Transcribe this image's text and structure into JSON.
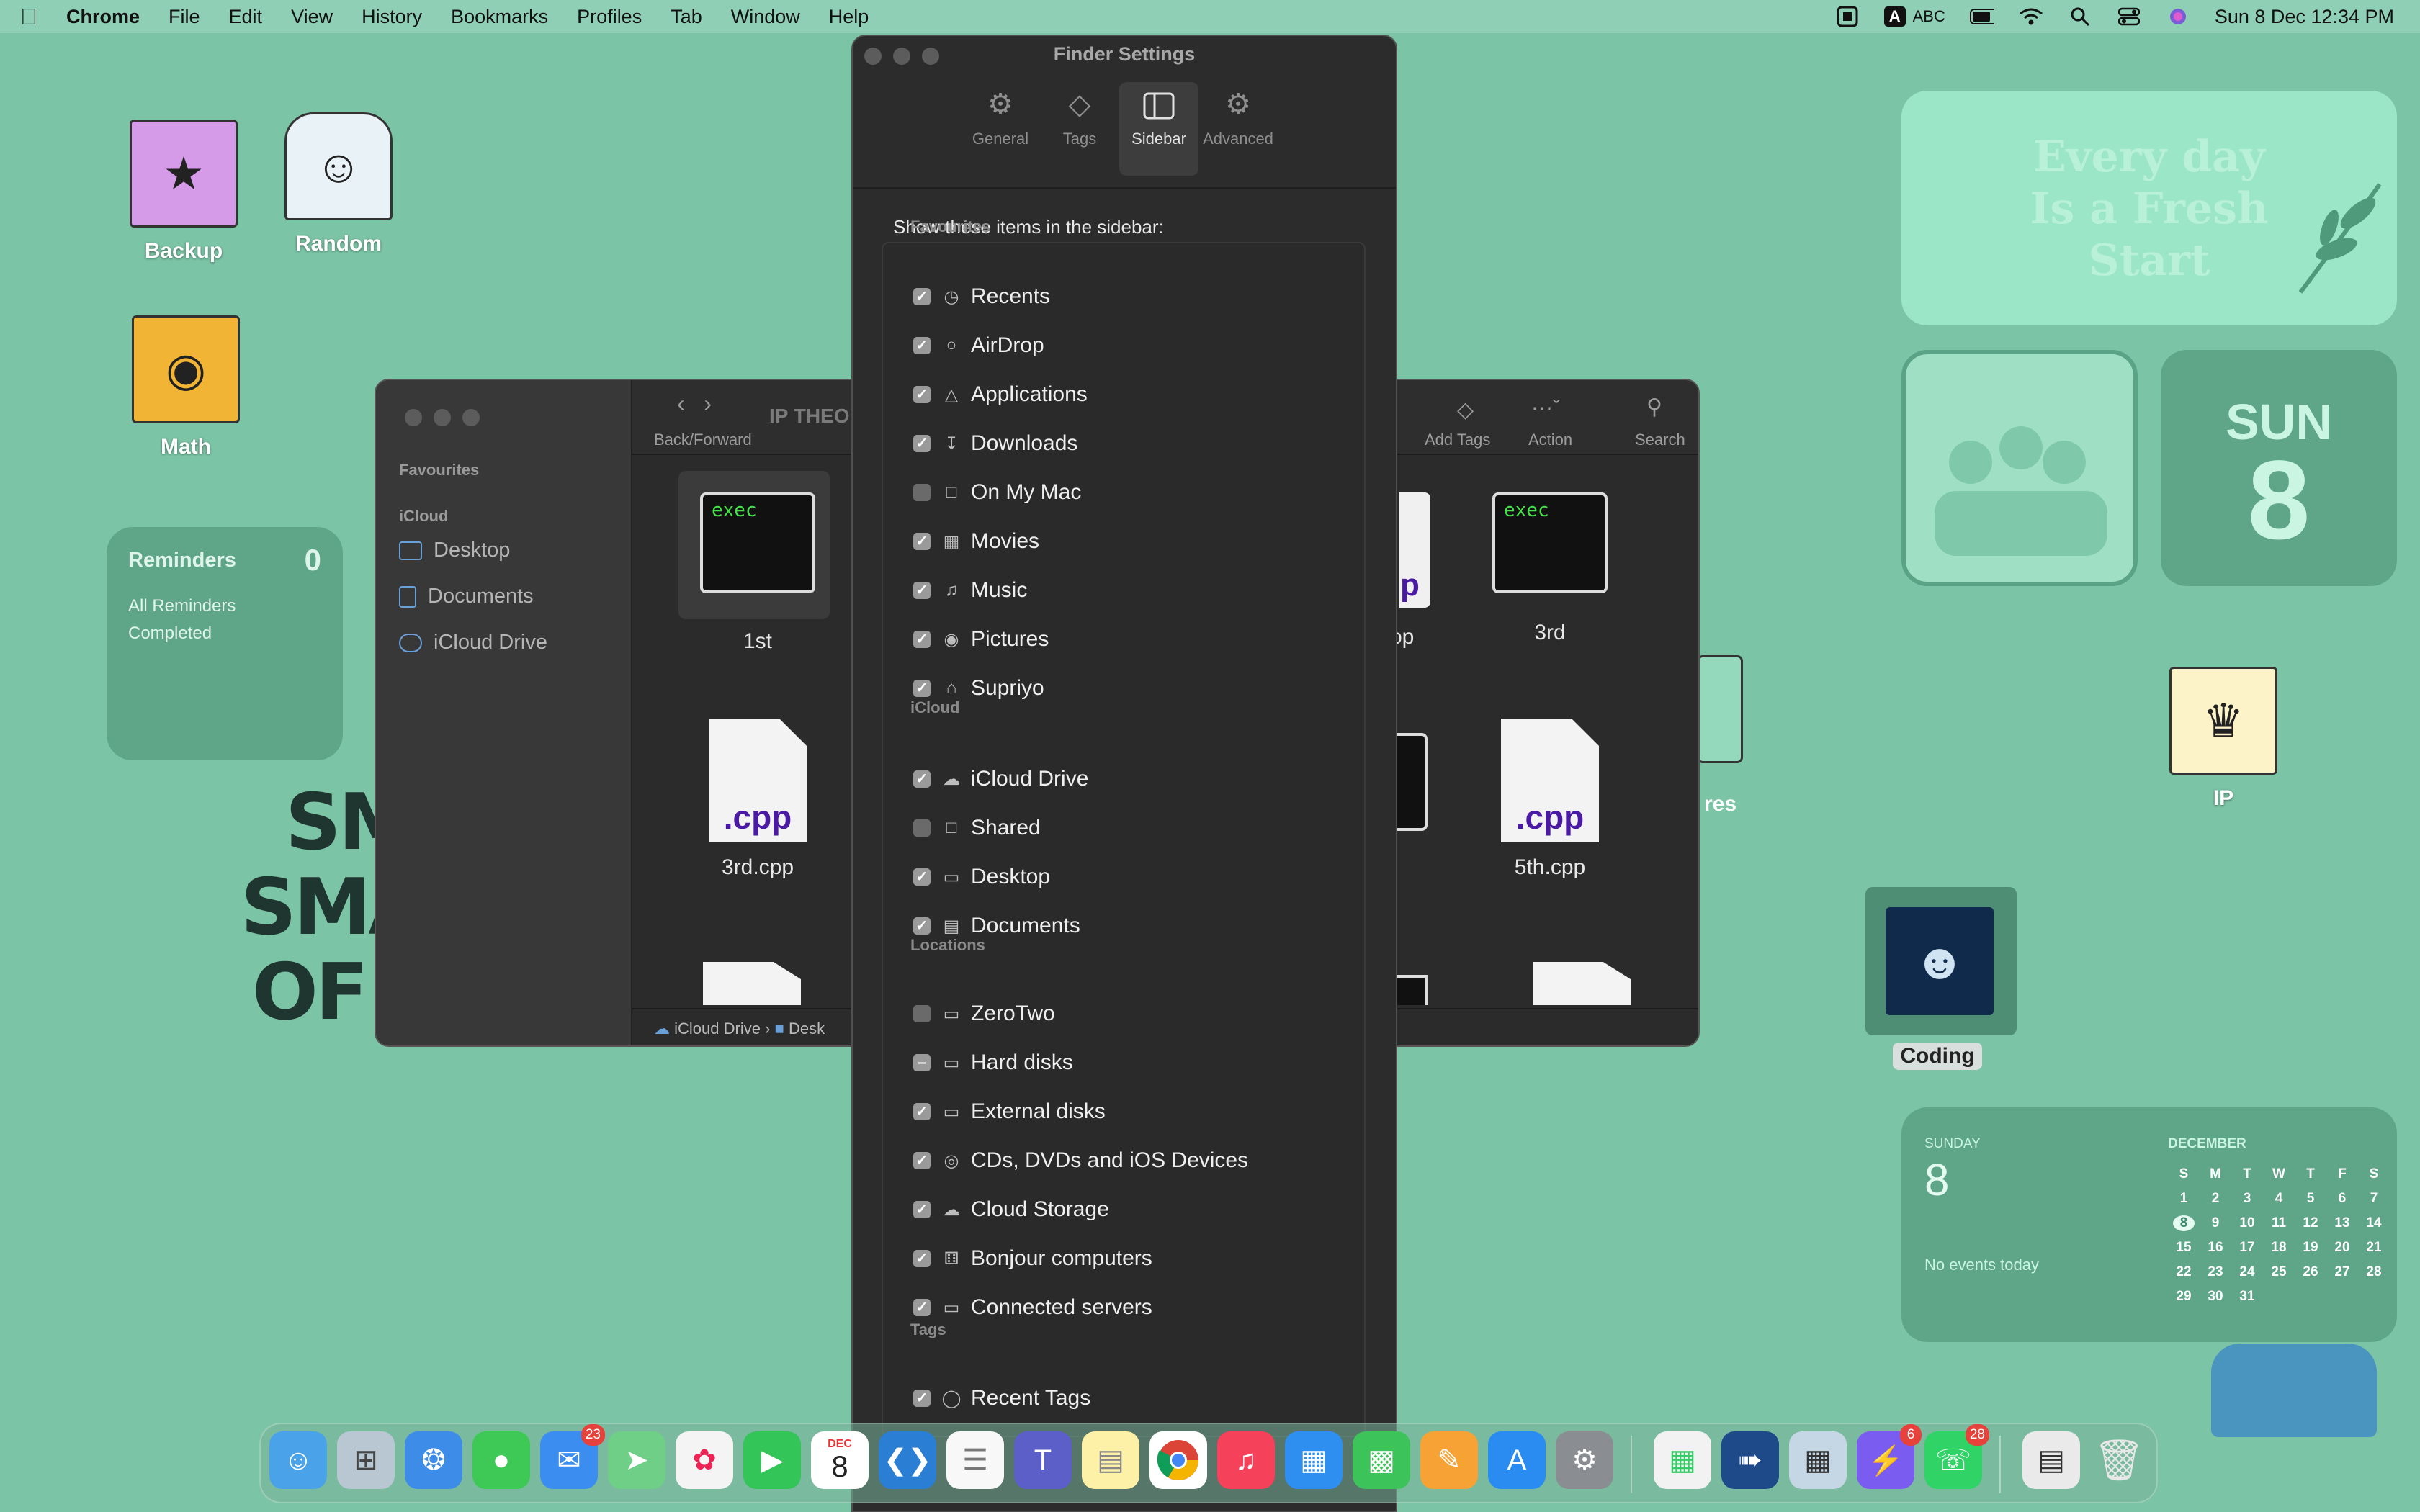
{
  "menubar": {
    "app": "Chrome",
    "items": [
      "File",
      "Edit",
      "View",
      "History",
      "Bookmarks",
      "Profiles",
      "Tab",
      "Window",
      "Help"
    ],
    "input_badge": "A",
    "input_source": "ABC",
    "datetime": "Sun 8 Dec  12:34 PM"
  },
  "desktop_icons": {
    "backup": "Backup",
    "random": "Random",
    "math": "Math",
    "ip": "IP",
    "coding": "Coding",
    "partial_res": "res"
  },
  "reminders": {
    "title": "Reminders",
    "count": "0",
    "line1": "All Reminders",
    "line2": "Completed"
  },
  "wallpaper_text": {
    "l1": "SM",
    "l2": "SMA",
    "l3": "OF S"
  },
  "quote": {
    "l1": "Every day",
    "l2": "Is a Fresh",
    "l3": "Start"
  },
  "date_widget": {
    "day": "SUN",
    "date": "8"
  },
  "calendar": {
    "weekday": "SUNDAY",
    "date": "8",
    "events": "No events today",
    "month": "DECEMBER",
    "headers": [
      "S",
      "M",
      "T",
      "W",
      "T",
      "F",
      "S"
    ],
    "days": [
      "1",
      "2",
      "3",
      "4",
      "5",
      "6",
      "7",
      "8",
      "9",
      "10",
      "11",
      "12",
      "13",
      "14",
      "15",
      "16",
      "17",
      "18",
      "19",
      "20",
      "21",
      "22",
      "23",
      "24",
      "25",
      "26",
      "27",
      "28",
      "29",
      "30",
      "31"
    ]
  },
  "finder": {
    "sidebar": {
      "favourites": "Favourites",
      "icloud": "iCloud",
      "items": [
        "Desktop",
        "Documents",
        "iCloud Drive"
      ]
    },
    "toolbar": {
      "back_forward": "Back/Forward",
      "title": "IP THEO",
      "add_tags": "Add Tags",
      "action": "Action",
      "search": "Search",
      "partial": "s"
    },
    "files": {
      "f1": "1st",
      "f2": "op",
      "f3": "3rd",
      "f4": "3rd.cpp",
      "f5": "5th.cpp",
      "exec": "exec",
      "cpp": ".cpp",
      "partial_p": "p"
    },
    "path": {
      "a": "iCloud Drive",
      "b": "Desk"
    }
  },
  "settings": {
    "title": "Finder Settings",
    "tabs": [
      "General",
      "Tags",
      "Sidebar",
      "Advanced"
    ],
    "heading": "Show these items in the sidebar:",
    "groups": {
      "favourites": "Favourites",
      "icloud": "iCloud",
      "locations": "Locations",
      "tags": "Tags"
    },
    "items": [
      {
        "label": "Recents",
        "state": "on"
      },
      {
        "label": "AirDrop",
        "state": "on"
      },
      {
        "label": "Applications",
        "state": "on"
      },
      {
        "label": "Downloads",
        "state": "on"
      },
      {
        "label": "On My Mac",
        "state": "off"
      },
      {
        "label": "Movies",
        "state": "on"
      },
      {
        "label": "Music",
        "state": "on"
      },
      {
        "label": "Pictures",
        "state": "on"
      },
      {
        "label": "Supriyo",
        "state": "on"
      },
      {
        "label": "iCloud Drive",
        "state": "on"
      },
      {
        "label": "Shared",
        "state": "off"
      },
      {
        "label": "Desktop",
        "state": "on"
      },
      {
        "label": "Documents",
        "state": "on"
      },
      {
        "label": "ZeroTwo",
        "state": "off"
      },
      {
        "label": "Hard disks",
        "state": "mixed"
      },
      {
        "label": "External disks",
        "state": "on"
      },
      {
        "label": "CDs, DVDs and iOS Devices",
        "state": "on"
      },
      {
        "label": "Cloud Storage",
        "state": "on"
      },
      {
        "label": "Bonjour computers",
        "state": "on"
      },
      {
        "label": "Connected servers",
        "state": "on"
      },
      {
        "label": "Recent Tags",
        "state": "on"
      }
    ]
  },
  "dock": {
    "mail_badge": "23",
    "calendar_month": "DEC",
    "calendar_day": "8",
    "messenger_badge": "6",
    "whatsapp_badge": "28"
  }
}
